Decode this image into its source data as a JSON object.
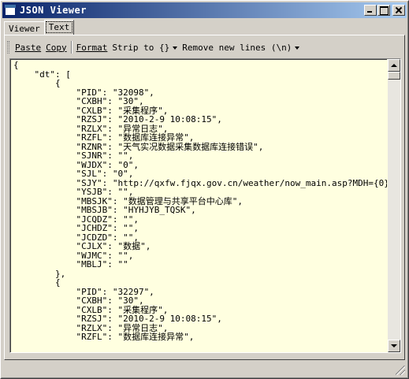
{
  "window": {
    "title": "JSON Viewer",
    "minimize_icon": "minimize-icon",
    "maximize_icon": "maximize-icon",
    "close_icon": "close-icon"
  },
  "tabs": [
    {
      "label": "Viewer",
      "active": false
    },
    {
      "label": "Text",
      "active": true
    }
  ],
  "toolbar": {
    "paste_label": "Paste",
    "copy_label": "Copy",
    "format_label": "Format",
    "strip_label": "Strip to {}",
    "remove_newlines_label": "Remove new lines (\\n)"
  },
  "editor": {
    "lines": [
      "{",
      "    \"dt\": [",
      "        {",
      "            \"PID\": \"32098\",",
      "            \"CXBH\": \"30\",",
      "            \"CXLB\": \"采集程序\",",
      "            \"RZSJ\": \"2010-2-9 10:08:15\",",
      "            \"RZLX\": \"异常日志\",",
      "            \"RZFL\": \"数据库连接异常\",",
      "            \"RZNR\": \"天气实况数据采集数据库连接错误\",",
      "            \"SJNR\": \"\",",
      "            \"WJDX\": \"0\",",
      "            \"SJL\": \"0\",",
      "            \"SJY\": \"http://qxfw.fjqx.gov.cn/weather/now_main.asp?MDH={0}\",",
      "            \"YSJB\": \"\",",
      "            \"MBSJK\": \"数据管理与共享平台中心库\",",
      "            \"MBSJB\": \"HYHJYB_TQSK\",",
      "            \"JCQDZ\": \"\",",
      "            \"JCHDZ\": \"\",",
      "            \"JCDZD\": \"\",",
      "            \"CJLX\": \"数据\",",
      "            \"WJMC\": \"\",",
      "            \"MBLJ\": \"\"",
      "        },",
      "        {",
      "            \"PID\": \"32297\",",
      "            \"CXBH\": \"30\",",
      "            \"CXLB\": \"采集程序\",",
      "            \"RZSJ\": \"2010-2-9 10:08:15\",",
      "            \"RZLX\": \"异常日志\",",
      "            \"RZFL\": \"数据库连接异常\","
    ]
  }
}
